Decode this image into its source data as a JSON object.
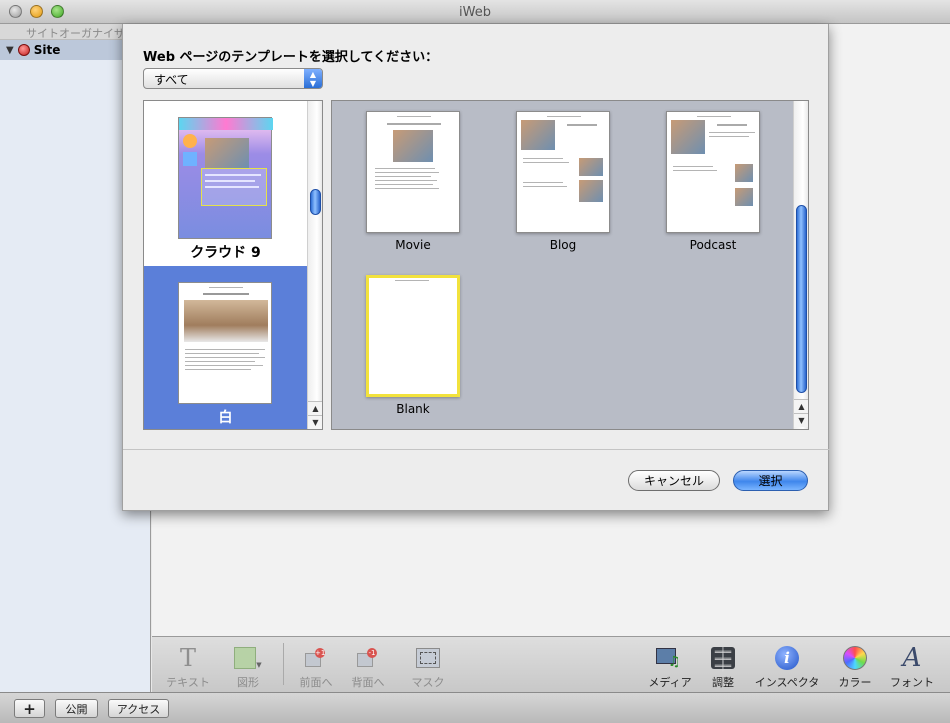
{
  "window": {
    "title": "iWeb"
  },
  "sidebar": {
    "header": "サイトオーガナイザ",
    "site_label": "Site"
  },
  "sheet": {
    "prompt": "Web ページのテンプレートを選択してください：",
    "popup_value": "すべて",
    "themes": [
      {
        "name": "クラウド 9",
        "selected": false
      },
      {
        "name": "白",
        "selected": true
      }
    ],
    "templates": [
      {
        "name": "Movie",
        "selected": false
      },
      {
        "name": "Blog",
        "selected": false
      },
      {
        "name": "Podcast",
        "selected": false
      },
      {
        "name": "Blank",
        "selected": true
      }
    ],
    "cancel_label": "キャンセル",
    "choose_label": "選択"
  },
  "toolbar": {
    "items": [
      {
        "label": "テキスト",
        "icon": "text-icon",
        "enabled": false
      },
      {
        "label": "図形",
        "icon": "shape-icon",
        "enabled": false
      },
      {
        "label": "前面へ",
        "icon": "bring-front-icon",
        "enabled": false
      },
      {
        "label": "背面へ",
        "icon": "send-back-icon",
        "enabled": false
      },
      {
        "label": "マスク",
        "icon": "mask-icon",
        "enabled": false
      },
      {
        "label": "メディア",
        "icon": "media-icon",
        "enabled": true
      },
      {
        "label": "調整",
        "icon": "adjust-icon",
        "enabled": true
      },
      {
        "label": "インスペクタ",
        "icon": "inspector-icon",
        "enabled": true
      },
      {
        "label": "カラー",
        "icon": "color-icon",
        "enabled": true
      },
      {
        "label": "フォント",
        "icon": "font-icon",
        "enabled": true
      }
    ]
  },
  "statusbar": {
    "add_label": "+",
    "publish_label": "公開",
    "visit_label": "アクセス"
  },
  "colors": {
    "selection_blue": "#5b7fd9",
    "template_highlight": "#f2e23c",
    "template_bg": "#b8bcc6"
  }
}
